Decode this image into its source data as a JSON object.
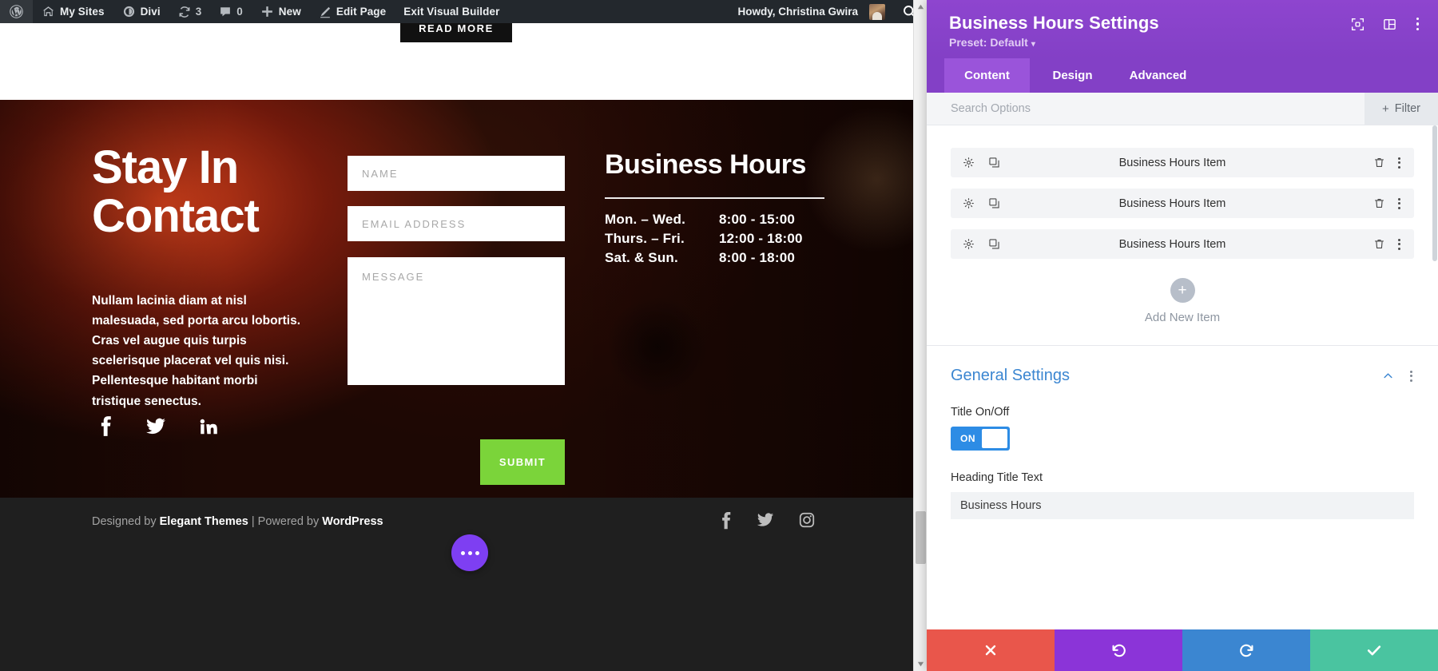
{
  "adminbar": {
    "wp_logo_icon": "wordpress-icon",
    "my_sites": "My Sites",
    "my_sites_icon": "sites-icon",
    "divi": "Divi",
    "divi_icon": "divi-icon",
    "updates_count": "3",
    "updates_icon": "updates-icon",
    "comments_count": "0",
    "comments_icon": "comment-icon",
    "new": "New",
    "new_icon": "plus-icon",
    "edit_page": "Edit Page",
    "edit_icon": "pencil-icon",
    "exit_visual_builder": "Exit Visual Builder",
    "howdy": "Howdy, Christina Gwira",
    "avatar_name": "user-avatar",
    "search_icon": "search-icon"
  },
  "page": {
    "read_more_button": "READ MORE",
    "hero": {
      "title": "Stay In Contact",
      "paragraph": "Nullam lacinia diam at nisl malesuada, sed porta arcu lobortis. Cras vel augue quis turpis scelerisque placerat vel quis nisi. Pellentesque habitant morbi tristique senectus.",
      "social": [
        {
          "name": "facebook-icon",
          "glyph": "f"
        },
        {
          "name": "twitter-icon",
          "glyph": "t"
        },
        {
          "name": "linkedin-icon",
          "glyph": "in"
        }
      ]
    },
    "form": {
      "name_placeholder": "NAME",
      "name_value": "",
      "email_placeholder": "EMAIL ADDRESS",
      "email_value": "",
      "message_placeholder": "MESSAGE",
      "message_value": "",
      "submit_label": "SUBMIT",
      "submit_color": "#7bd43a"
    },
    "business_hours": {
      "title": "Business Hours",
      "rows": [
        {
          "day": "Mon. – Wed.",
          "time": "8:00 - 15:00"
        },
        {
          "day": "Thurs. – Fri.",
          "time": "12:00 - 18:00"
        },
        {
          "day": "Sat. & Sun.",
          "time": "8:00 - 18:00"
        }
      ]
    },
    "footer": {
      "designed_by_prefix": "Designed by ",
      "designed_by_brand": "Elegant Themes",
      "separator": " | ",
      "powered_by_prefix": "Powered by ",
      "powered_by_brand": "WordPress",
      "social": [
        {
          "name": "facebook-icon"
        },
        {
          "name": "twitter-icon"
        },
        {
          "name": "instagram-icon"
        }
      ],
      "fab_name": "divi-page-settings-button",
      "fab_color": "#7e3ff2"
    }
  },
  "panel": {
    "title": "Business Hours Settings",
    "preset": "Preset: Default",
    "accent_color": "#8b44ca",
    "header_icons": [
      {
        "name": "focus-module-icon"
      },
      {
        "name": "layout-columns-icon"
      },
      {
        "name": "panel-more-icon"
      }
    ],
    "tabs": [
      {
        "label": "Content",
        "active": true
      },
      {
        "label": "Design",
        "active": false
      },
      {
        "label": "Advanced",
        "active": false
      }
    ],
    "search": {
      "placeholder": "Search Options",
      "value": "",
      "filter_label": "Filter",
      "filter_plus": "+"
    },
    "items": [
      {
        "label": "Business Hours Item"
      },
      {
        "label": "Business Hours Item"
      },
      {
        "label": "Business Hours Item"
      }
    ],
    "add_new": {
      "plus": "+",
      "label": "Add New Item"
    },
    "general_settings": {
      "title": "General Settings",
      "title_color": "#3b86d1",
      "title_onoff_label": "Title On/Off",
      "title_onoff_state": "ON",
      "toggle_color": "#2d8ce5",
      "heading_title_label": "Heading Title Text",
      "heading_title_value": "Business Hours"
    },
    "actions": [
      {
        "name": "cancel-button",
        "color": "#e9564b",
        "glyph": "✕"
      },
      {
        "name": "undo-button",
        "color": "#8b34d8",
        "glyph": "↺"
      },
      {
        "name": "redo-button",
        "color": "#3b86d1",
        "glyph": "↻"
      },
      {
        "name": "save-button",
        "color": "#4ac4a0",
        "glyph": "✔"
      }
    ]
  }
}
